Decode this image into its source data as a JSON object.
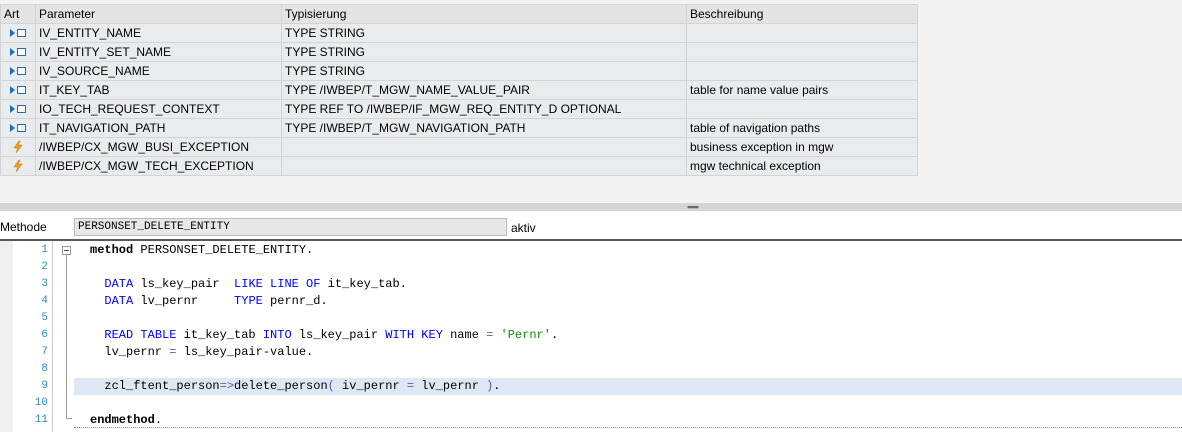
{
  "table": {
    "headers": {
      "art": "Art",
      "param": "Parameter",
      "typ": "Typisierung",
      "beschr": "Beschreibung"
    },
    "rows": [
      {
        "icon": "importing-parameter-icon",
        "param": "IV_ENTITY_NAME",
        "typ": "TYPE STRING",
        "beschr": ""
      },
      {
        "icon": "importing-parameter-icon",
        "param": "IV_ENTITY_SET_NAME",
        "typ": "TYPE STRING",
        "beschr": ""
      },
      {
        "icon": "importing-parameter-icon",
        "param": "IV_SOURCE_NAME",
        "typ": "TYPE STRING",
        "beschr": ""
      },
      {
        "icon": "importing-parameter-icon",
        "param": "IT_KEY_TAB",
        "typ": "TYPE /IWBEP/T_MGW_NAME_VALUE_PAIR",
        "beschr": "table for name value pairs"
      },
      {
        "icon": "importing-parameter-icon",
        "param": "IO_TECH_REQUEST_CONTEXT",
        "typ": "TYPE REF TO /IWBEP/IF_MGW_REQ_ENTITY_D OPTIONAL",
        "beschr": ""
      },
      {
        "icon": "importing-parameter-icon",
        "param": "IT_NAVIGATION_PATH",
        "typ": "TYPE /IWBEP/T_MGW_NAVIGATION_PATH",
        "beschr": "table of navigation paths"
      },
      {
        "icon": "exception-icon",
        "param": "/IWBEP/CX_MGW_BUSI_EXCEPTION",
        "typ": "",
        "beschr": "business exception in mgw"
      },
      {
        "icon": "exception-icon",
        "param": "/IWBEP/CX_MGW_TECH_EXCEPTION",
        "typ": "",
        "beschr": "mgw technical exception"
      }
    ]
  },
  "method": {
    "label": "Methode",
    "name": "PERSONSET_DELETE_ENTITY",
    "status": "aktiv"
  },
  "editor": {
    "current_line": 9,
    "lines": [
      {
        "n": "1",
        "tokens": [
          {
            "t": "method",
            "c": "bold"
          },
          {
            "t": " PERSONSET_DELETE_ENTITY."
          }
        ]
      },
      {
        "n": "2",
        "tokens": []
      },
      {
        "n": "3",
        "tokens": [
          {
            "t": "  "
          },
          {
            "t": "DATA",
            "c": "kw"
          },
          {
            "t": " ls_key_pair  "
          },
          {
            "t": "LIKE LINE OF",
            "c": "kw"
          },
          {
            "t": " it_key_tab."
          }
        ]
      },
      {
        "n": "4",
        "tokens": [
          {
            "t": "  "
          },
          {
            "t": "DATA",
            "c": "kw"
          },
          {
            "t": " lv_pernr     "
          },
          {
            "t": "TYPE",
            "c": "kw"
          },
          {
            "t": " pernr_d."
          }
        ]
      },
      {
        "n": "5",
        "tokens": []
      },
      {
        "n": "6",
        "tokens": [
          {
            "t": "  "
          },
          {
            "t": "READ TABLE",
            "c": "kw"
          },
          {
            "t": " it_key_tab "
          },
          {
            "t": "INTO",
            "c": "kw"
          },
          {
            "t": " ls_key_pair "
          },
          {
            "t": "WITH KEY",
            "c": "kw"
          },
          {
            "t": " name "
          },
          {
            "t": "=",
            "c": "op"
          },
          {
            "t": " "
          },
          {
            "t": "'Pernr'",
            "c": "str"
          },
          {
            "t": "."
          }
        ]
      },
      {
        "n": "7",
        "tokens": [
          {
            "t": "  lv_pernr "
          },
          {
            "t": "=",
            "c": "op"
          },
          {
            "t": " ls_key_pair-value."
          }
        ]
      },
      {
        "n": "8",
        "tokens": []
      },
      {
        "n": "9",
        "tokens": [
          {
            "t": "  zcl_ftent_person"
          },
          {
            "t": "=>",
            "c": "op"
          },
          {
            "t": "delete_person"
          },
          {
            "t": "(",
            "c": "op"
          },
          {
            "t": " iv_pernr "
          },
          {
            "t": "=",
            "c": "op"
          },
          {
            "t": " lv_pernr "
          },
          {
            "t": ")",
            "c": "op"
          },
          {
            "t": "."
          }
        ]
      },
      {
        "n": "10",
        "tokens": []
      },
      {
        "n": "11",
        "tokens": [
          {
            "t": "endmethod",
            "c": "bold"
          },
          {
            "t": "."
          }
        ]
      }
    ]
  },
  "colors": {
    "keyword": "#0000ff",
    "string": "#0f8a0f",
    "operator": "#7a4e9e",
    "current_line": "#dde8f5",
    "line_number": "#2b91af"
  }
}
